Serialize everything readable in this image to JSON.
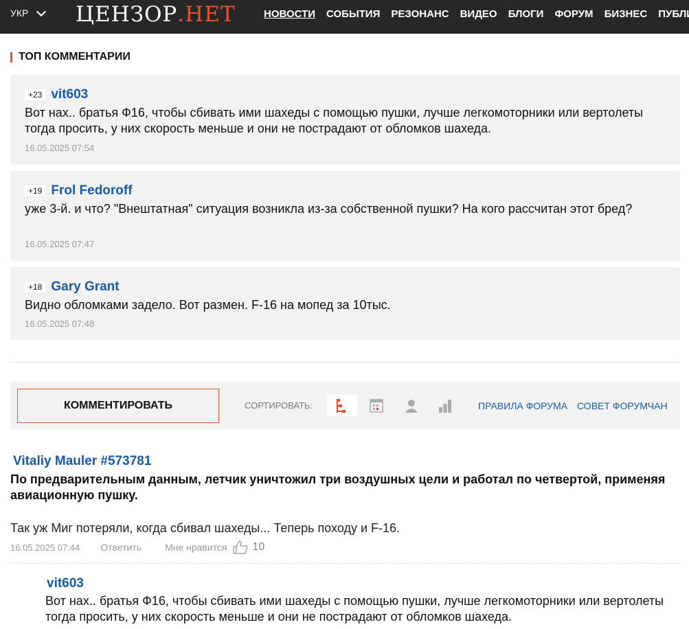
{
  "header": {
    "lang": "УКР",
    "logo_main": "ЦЕНЗОР",
    "logo_dot": ".",
    "logo_accent": "НЕТ",
    "nav": [
      "НОВОСТИ",
      "СОБЫТИЯ",
      "РЕЗОНАНС",
      "ВИДЕО",
      "БЛОГИ",
      "ФОРУМ",
      "БИЗНЕС",
      "ПУБЛИ"
    ]
  },
  "top_comments": {
    "title": "ТОП КОММЕНТАРИИ",
    "items": [
      {
        "score": "+23",
        "author": "vit603",
        "text": "Вот нах.. братья Ф16, чтобы сбивать ими шахеды с помощью пушки, лучше легкомоторники или вертолеты тогда просить, у них скорость меньше и они не пострадают от обломков шахеда.",
        "date": "16.05.2025 07:54"
      },
      {
        "score": "+19",
        "author": "Frol Fedoroff",
        "text": "уже 3-й. и что? \"Внештатная\" ситуация возникла из-за собственной пушки? На кого рассчитан этот бред?",
        "date": "16.05.2025 07:47"
      },
      {
        "score": "+18",
        "author": "Gary Grant",
        "text": "Видно обломками задело. Вот размен. F-16 на мопед за 10тыс.",
        "date": "16.05.2025 07:48"
      }
    ]
  },
  "toolbar": {
    "comment_button": "КОММЕНТИРОВАТЬ",
    "sort_label": "СОРТИРОВАТЬ:",
    "rules_link": "ПРАВИЛА ФОРУМА",
    "council_link": "СОВЕТ ФОРУМЧАН",
    "accent_color": "#e8542a"
  },
  "comment": {
    "author": "Vitaliy Mauler #573781",
    "quote": "По предварительным данным, летчик уничтожил три воздушных цели и работал по четвертой, применяя авиационную пушку.",
    "text": "Так уж Миг потеряли, когда сбивал шахеды... Теперь походу и F-16.",
    "date": "16.05.2025 07:44",
    "reply": "Ответить",
    "like_label": "Мне нравится",
    "like_count": "10"
  },
  "reply": {
    "author": "vit603",
    "text": "Вот нах.. братья Ф16, чтобы сбивать ими шахеды с помощью пушки, лучше легкомоторники или вертолеты тогда просить, у них скорость меньше и они не пострадают от обломков шахеда."
  }
}
